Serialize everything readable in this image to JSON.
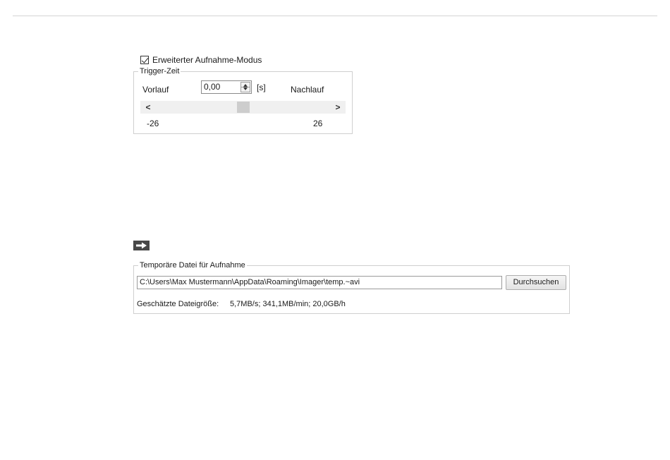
{
  "extended_mode": {
    "label": "Erweiterter Aufnahme-Modus",
    "checked": true
  },
  "trigger": {
    "group_title": "Trigger-Zeit",
    "pre_label": "Vorlauf",
    "post_label": "Nachlauf",
    "value": "0,00",
    "unit": "[s]",
    "slider": {
      "min_label": "-26",
      "max_label": "26",
      "left_arrow": "<",
      "right_arrow": ">",
      "min": -26,
      "max": 26,
      "value": 0
    }
  },
  "icons": {
    "arrow": "arrow-right-icon"
  },
  "temp_file": {
    "group_title": "Temporäre Datei für Aufnahme",
    "path": "C:\\Users\\Max Mustermann\\AppData\\Roaming\\Imager\\temp.~avi",
    "browse_label": "Durchsuchen",
    "size_label": "Geschätzte Dateigröße:",
    "size_value": "5,7MB/s; 341,1MB/min; 20,0GB/h"
  }
}
